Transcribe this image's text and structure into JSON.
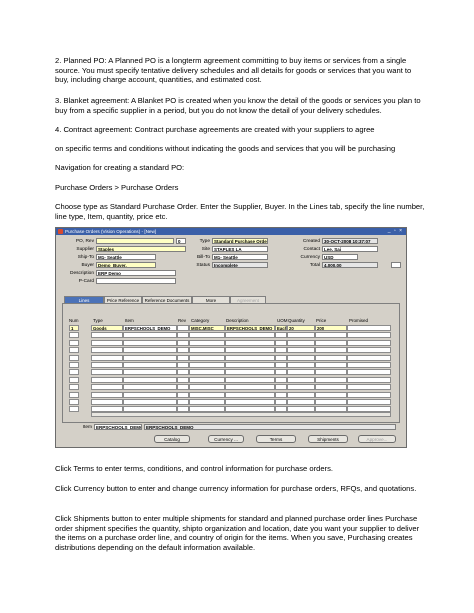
{
  "paragraphs": {
    "p1": "2. Planned PO:  A Planned PO is a longterm agreement committing to buy items or services from a single source. You must specify tentative delivery schedules and all details for goods or services that you want to buy, including charge account, quantities, and estimated cost.",
    "p2": "3. Blanket agreement: A Blanket PO is created when you know the detail of the goods or services you plan to buy from a specific supplier in a period, but you do not know the detail of your delivery schedules.",
    "p3": "4. Contract agreement: Contract purchase agreements are created with your suppliers to agree",
    "p4": "on specific terms and conditions without indicating the goods and services that you will be purchasing",
    "p5": "Navigation for creating a standard PO:",
    "p6": "Purchase Orders > Purchase Orders",
    "p7": "Choose type as Standard Purchase Order. Enter the Supplier, Buyer. In the Lines tab, specify the line number, line type, Item, quantity, price etc.",
    "p8": "Click Terms to enter terms, conditions, and control information for purchase orders.",
    "p9": "Click Currency button to enter and change currency information for purchase orders, RFQs, and quotations.",
    "p10": "Click Shipments button to enter multiple shipments for standard and planned purchase order lines Purchase order shipment specifies the quantity, shipto organization and location, date you want your supplier to deliver the items on a purchase order line, and country of origin for the items. When you save, Purchasing creates distributions depending on the default information available."
  },
  "form": {
    "title": "Purchase Orders (Vision Operations) - [New]",
    "window_controls": "_ ▫ ×",
    "header": {
      "po_rev_label": "PO, Rev",
      "po_number": "",
      "rev": "0",
      "type_label": "Type",
      "type": "Standard Purchase Order",
      "created_label": "Created",
      "created": "30-OCT-2008 10:37:07",
      "supplier_label": "Supplier",
      "supplier": "Staples",
      "site_label": "Site",
      "site": "STAPLES LA",
      "contact_label": "Contact",
      "contact": "Lee, Sai",
      "shipto_label": "Ship-To",
      "shipto": "M1- Seattle",
      "billto_label": "Bill-To",
      "billto": "M1- Seattle",
      "currency_label": "Currency",
      "currency": "USD",
      "buyer_label": "Buyer",
      "buyer": "Demo_Buyer,",
      "status_label": "Status",
      "status": "Incomplete",
      "total_label": "Total",
      "total": "4,000.00",
      "description_label": "Description",
      "description": "ERP Demo",
      "pcard_label": "P-Card",
      "pcard": ""
    },
    "tabs": [
      "Lines",
      "Price Reference",
      "Reference Documents",
      "More",
      "Agreement"
    ],
    "columns": {
      "num": "Num",
      "type": "Type",
      "item": "Item",
      "rev": "Rev",
      "category": "Category",
      "description": "Description",
      "uom": "UOM",
      "quantity": "Quantity",
      "price": "Price",
      "promised": "Promised"
    },
    "line": {
      "num": "1",
      "type": "Goods",
      "item": "ERPSCHOOLS_DEMO",
      "rev": "",
      "category": "MISC.MISC",
      "description": "ERPSCHOOLS_DEMO",
      "uom": "Each",
      "quantity": "20",
      "price": "200",
      "promised": ""
    },
    "item_label": "Item",
    "item_code": "ERPSCHOOLS_DEMO",
    "item_desc": "ERPSCHOOLS_DEMO",
    "buttons": [
      "Catalog",
      "Currency ...",
      "Terms",
      "Shipments",
      "Approve..."
    ]
  }
}
